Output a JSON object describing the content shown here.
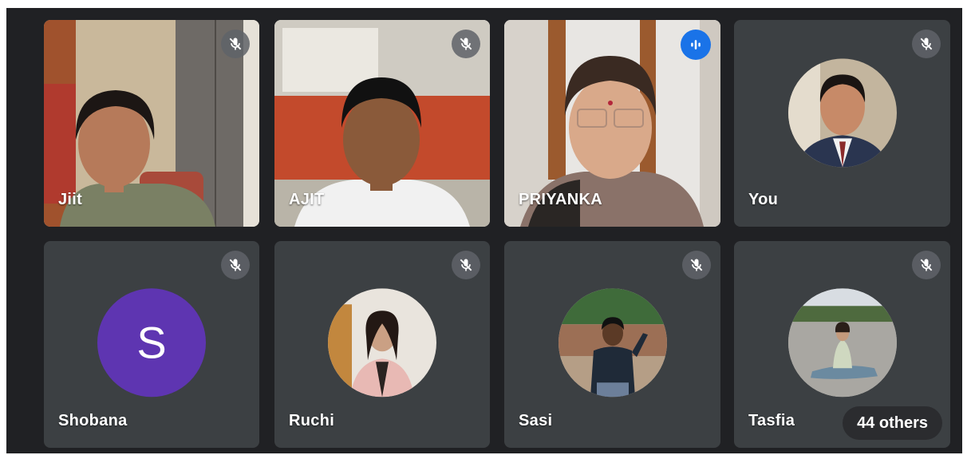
{
  "tiles": [
    {
      "name": "Jiit",
      "mic": "mic-off-icon",
      "media": "video"
    },
    {
      "name": "AJIT",
      "mic": "mic-off-icon",
      "media": "video"
    },
    {
      "name": "PRIYANKA",
      "mic": "speaking-indicator-icon",
      "media": "video"
    },
    {
      "name": "You",
      "mic": "mic-off-icon",
      "media": "avatar-photo"
    },
    {
      "name": "Shobana",
      "mic": "mic-off-icon",
      "media": "avatar-letter",
      "initial": "S",
      "avatar_color": "#5e35b1"
    },
    {
      "name": "Ruchi",
      "mic": "mic-off-icon",
      "media": "avatar-photo"
    },
    {
      "name": "Sasi",
      "mic": "mic-off-icon",
      "media": "avatar-photo"
    },
    {
      "name": "Tasfia",
      "mic": "mic-off-icon",
      "media": "avatar-photo"
    }
  ],
  "others_label": "44 others",
  "colors": {
    "background": "#202124",
    "tile": "#3c4043",
    "speaking": "#1a73e8",
    "mic_badge": "#5f6368"
  }
}
